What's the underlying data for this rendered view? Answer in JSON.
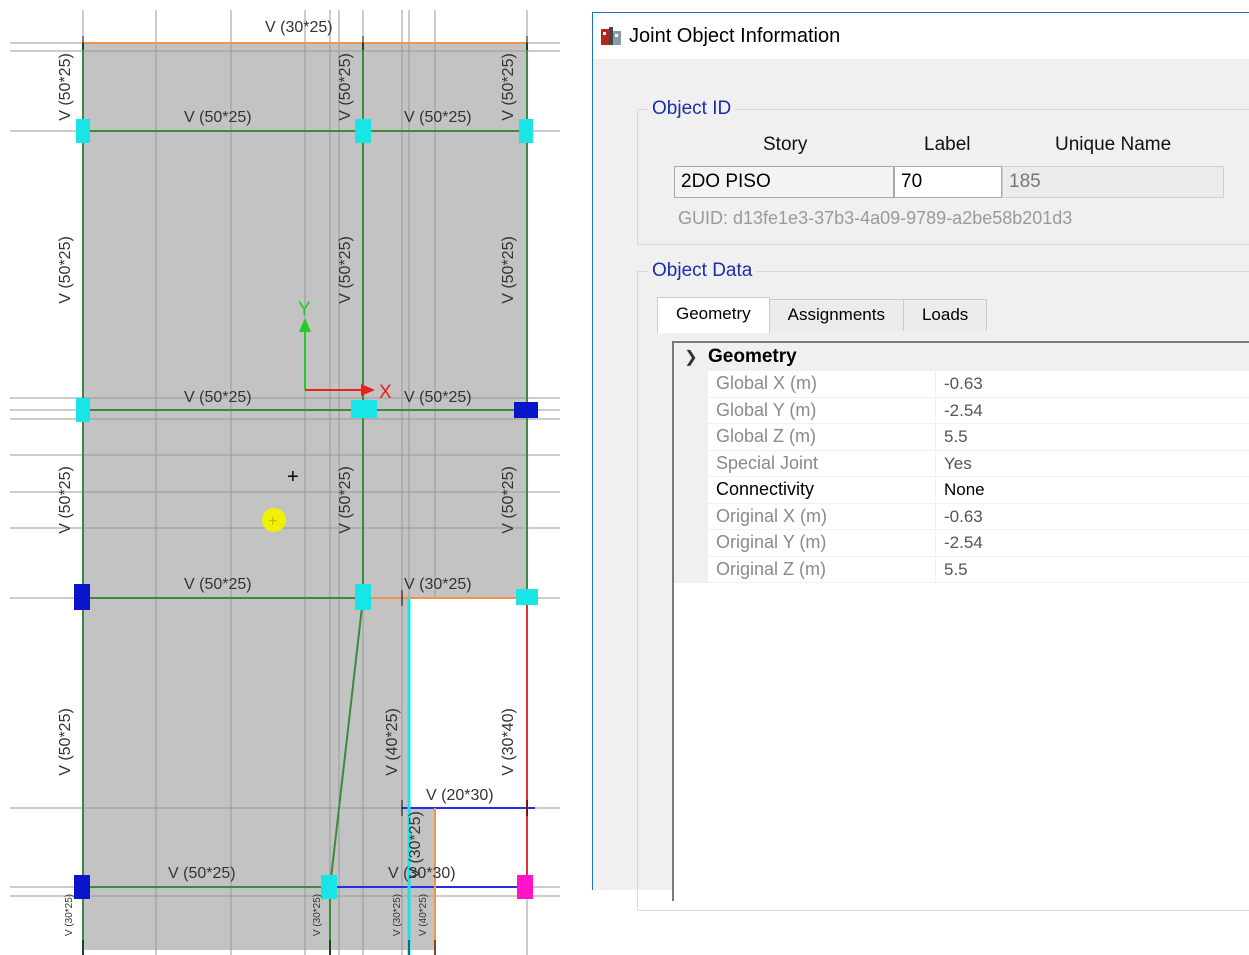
{
  "plan": {
    "top_beam_label": "V (30*25)",
    "axis_x_label": "X",
    "axis_y_label": "Y",
    "horizontal_labels": [
      "V (50*25)",
      "V (50*25)",
      "V (50*25)",
      "V (50*25)",
      "V (50*25)",
      "V (30*25)",
      "V (20*30)",
      "V (50*25)",
      "V (30*30)"
    ],
    "vertical_labels": [
      "V (50*25)",
      "V (50*25)",
      "V (50*25)",
      "V (50*25)",
      "V (50*25)",
      "V (50*25)",
      "V (50*25)",
      "V (50*25)",
      "V (50*25)",
      "V (50*25)",
      "V (40*25)",
      "V (30*40)",
      "V (30*25)",
      "V (30*25)",
      "V (30*25)",
      "V (40*25)",
      "V (30*25)"
    ],
    "colors": {
      "slab": "#c3c3c3",
      "beam_green": "#3c8a3c",
      "beam_orange": "#f2954a",
      "beam_red": "#e03030",
      "beam_blue": "#2a2ae8",
      "joint_cyan": "#18e6e6",
      "joint_blue": "#0a14c8",
      "joint_magenta": "#ff14c8",
      "cursor_yellow": "#f0f000"
    }
  },
  "dialog": {
    "title": "Joint Object Information",
    "object_id": {
      "legend": "Object ID",
      "col_story": "Story",
      "col_label": "Label",
      "col_unique": "Unique Name",
      "story_value": "2DO PISO",
      "label_value": "70",
      "unique_value": "185",
      "guid": "GUID:  d13fe1e3-37b3-4a09-9789-a2be58b201d3"
    },
    "object_data": {
      "legend": "Object Data",
      "tabs": [
        "Geometry",
        "Assignments",
        "Loads"
      ],
      "category": "Geometry",
      "rows": [
        {
          "name": "Global X (m)",
          "value": "-0.63"
        },
        {
          "name": "Global Y (m)",
          "value": "-2.54"
        },
        {
          "name": "Global Z (m)",
          "value": "5.5"
        },
        {
          "name": "Special Joint",
          "value": "Yes"
        },
        {
          "name": "Connectivity",
          "value": "None"
        },
        {
          "name": "Original X (m)",
          "value": "-0.63"
        },
        {
          "name": "Original Y (m)",
          "value": "-2.54"
        },
        {
          "name": "Original Z (m)",
          "value": "5.5"
        }
      ]
    }
  }
}
